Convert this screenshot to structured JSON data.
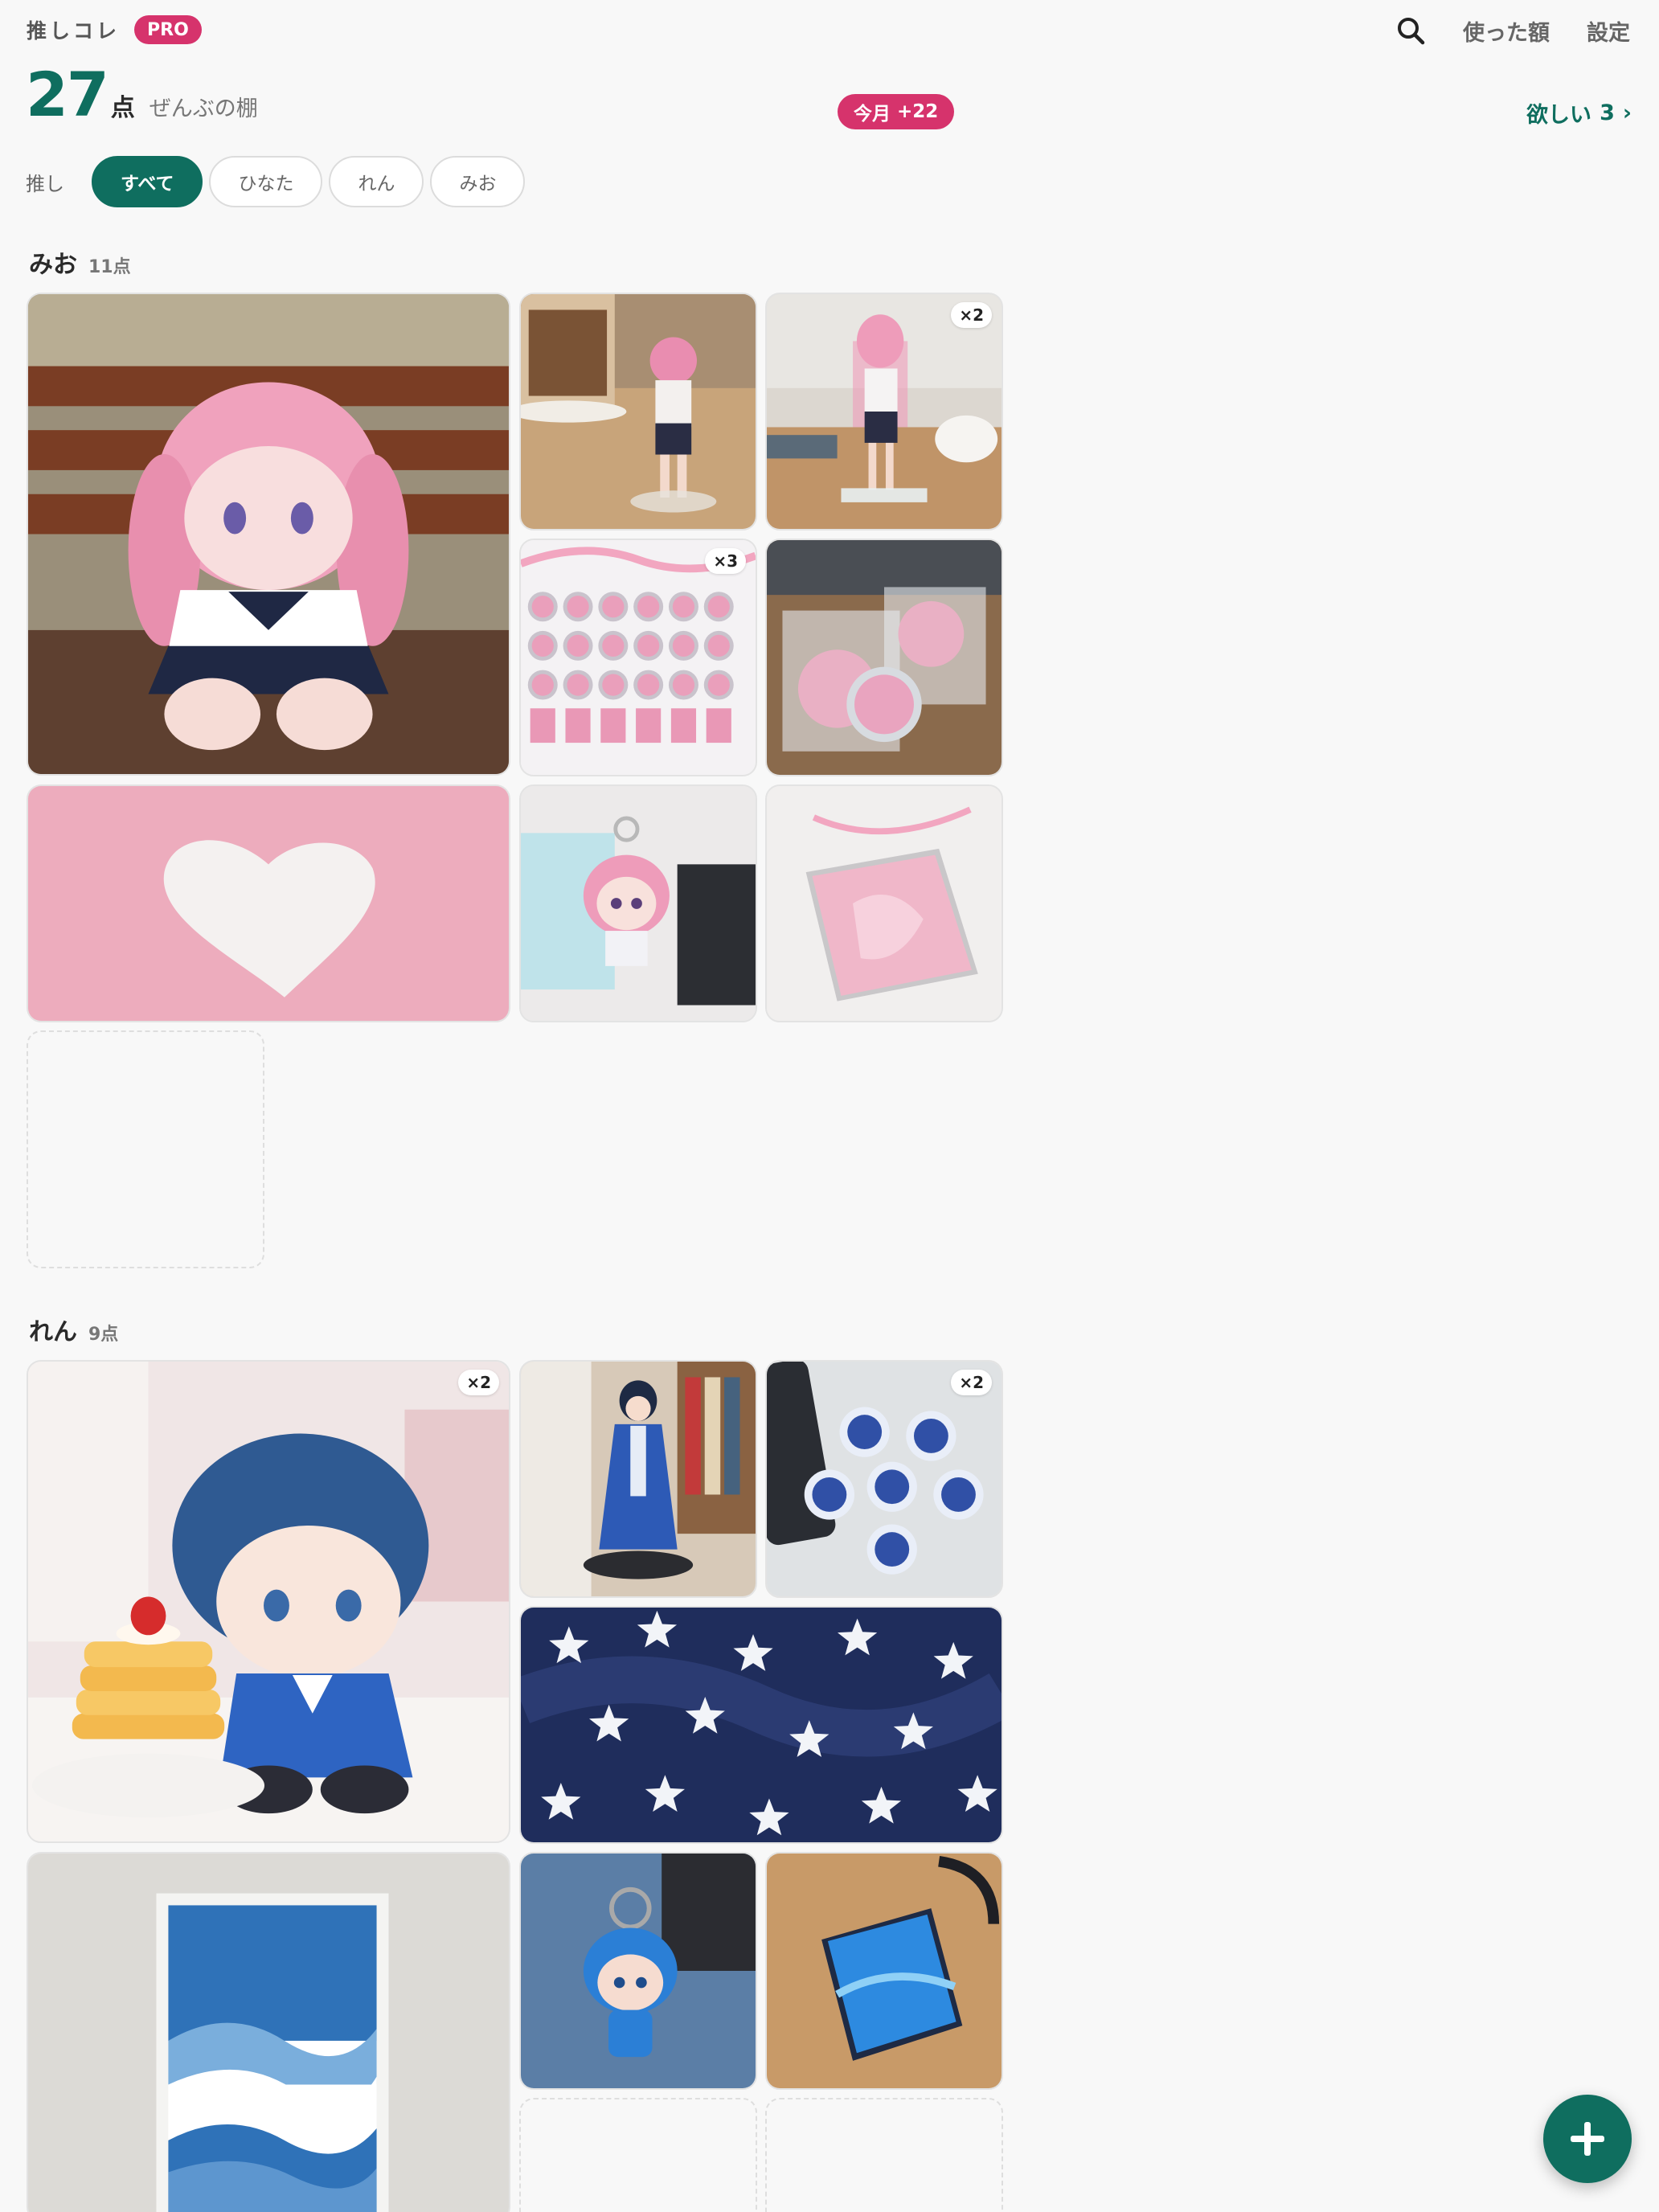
{
  "header": {
    "brand": "推しコレ",
    "pro_badge": "PRO",
    "spent_link": "使った額",
    "settings_link": "設定",
    "search_icon": "search-icon"
  },
  "summary": {
    "count": "27",
    "unit": "点",
    "label": "ぜんぶの棚",
    "month_badge_label": "今月",
    "month_badge_value": "+22",
    "want_label": "欲しい",
    "want_count": "3",
    "want_chevron": "›"
  },
  "filter": {
    "label": "推し",
    "chips": [
      "すべて",
      "ひなた",
      "れん",
      "みお"
    ],
    "active": "すべて"
  },
  "sections": [
    {
      "name": "みお",
      "count": "11点",
      "items": [
        {
          "subject": "pink plush doll on bench",
          "qty": ""
        },
        {
          "subject": "acrylic stand by latte",
          "qty": ""
        },
        {
          "subject": "acrylic stand on table",
          "qty": "×2"
        },
        {
          "subject": "badge collection sheet",
          "qty": "×3"
        },
        {
          "subject": "can badges in bags",
          "qty": ""
        },
        {
          "subject": "pink towel with heart",
          "qty": ""
        },
        {
          "subject": "chibi acrylic keychain",
          "qty": ""
        },
        {
          "subject": "pink CD case",
          "qty": ""
        },
        {
          "subject": "empty slot",
          "qty": ""
        }
      ]
    },
    {
      "name": "れん",
      "count": "9点",
      "items": [
        {
          "subject": "blue plush with pancakes",
          "qty": "×2"
        },
        {
          "subject": "blue acrylic figure",
          "qty": ""
        },
        {
          "subject": "blue can badges",
          "qty": "×2"
        },
        {
          "subject": "navy star towel",
          "qty": ""
        },
        {
          "subject": "blue wave poster",
          "qty": ""
        },
        {
          "subject": "blue rubber keychain",
          "qty": ""
        },
        {
          "subject": "blue CD case",
          "qty": ""
        },
        {
          "subject": "empty slot",
          "qty": ""
        },
        {
          "subject": "empty slot",
          "qty": ""
        }
      ]
    }
  ],
  "fab": {
    "icon": "plus-icon"
  },
  "colors": {
    "accent": "#0f6e5f",
    "pink": "#d6336c",
    "background": "#f8f8f8"
  }
}
